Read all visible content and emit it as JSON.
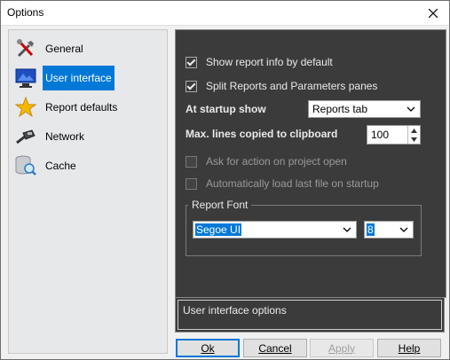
{
  "window": {
    "title": "Options"
  },
  "sidebar": {
    "items": [
      {
        "label": "General",
        "icon": "tools-icon"
      },
      {
        "label": "User interface",
        "icon": "monitor-icon",
        "selected": true
      },
      {
        "label": "Report defaults",
        "icon": "star-icon"
      },
      {
        "label": "Network",
        "icon": "network-cable-icon"
      },
      {
        "label": "Cache",
        "icon": "database-search-icon"
      }
    ]
  },
  "panel": {
    "show_report_info": {
      "label": "Show report info by default",
      "checked": true
    },
    "split_panes": {
      "label": "Split Reports and Parameters panes",
      "checked": true
    },
    "startup_show": {
      "label": "At startup show",
      "value": "Reports tab"
    },
    "max_lines": {
      "label": "Max. lines copied to clipboard",
      "value": "100"
    },
    "ask_action": {
      "label": "Ask for action on project open",
      "checked": false
    },
    "auto_load": {
      "label": "Automatically load last file on startup",
      "checked": false
    },
    "report_font": {
      "label": "Report Font",
      "family": "Segoe UI",
      "size": "8"
    }
  },
  "description": {
    "text": "User interface options"
  },
  "buttons": {
    "ok": "Ok",
    "cancel": "Cancel",
    "apply": "Apply",
    "help": "Help"
  },
  "colors": {
    "accent": "#0078d7",
    "panel_bg": "#3b3b3b"
  }
}
